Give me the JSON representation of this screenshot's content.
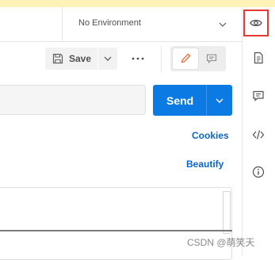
{
  "environment": {
    "selected": "No Environment",
    "chevron_icon": "chevron-down-icon"
  },
  "toolbar": {
    "save_label": "Save",
    "save_icon": "floppy-disk-icon",
    "more_icon": "ellipsis-icon",
    "mode_edit_icon": "pencil-icon",
    "mode_comment_icon": "comment-icon"
  },
  "request": {
    "url_value": "",
    "send_label": "Send"
  },
  "links": {
    "cookies": "Cookies",
    "beautify": "Beautify"
  },
  "sidebar": {
    "items": [
      {
        "icon": "eye-icon",
        "highlighted": true
      },
      {
        "icon": "document-icon"
      },
      {
        "icon": "comment-icon"
      },
      {
        "icon": "code-icon"
      },
      {
        "icon": "info-icon"
      }
    ]
  },
  "watermark": "CSDN @萌笑天",
  "colors": {
    "accent": "#0b7be3",
    "link": "#0b65c8",
    "highlight_border": "#e53935",
    "edit_icon": "#f26b3a",
    "top_strip": "#fdf2b8"
  }
}
